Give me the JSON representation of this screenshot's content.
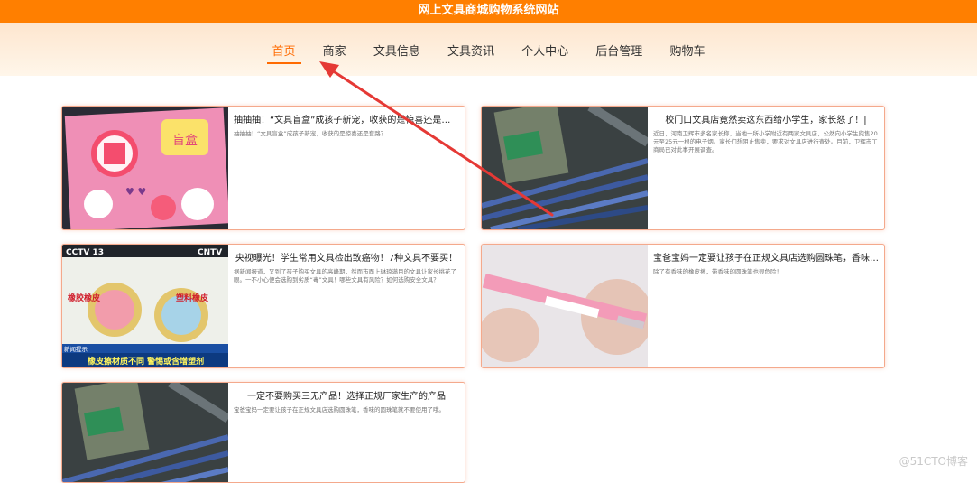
{
  "header": {
    "site_title": "网上文具商城购物系统网站"
  },
  "nav": {
    "items": [
      "首页",
      "商家",
      "文具信息",
      "文具资讯",
      "个人中心",
      "后台管理",
      "购物车"
    ],
    "active": "首页"
  },
  "articles": [
    {
      "title": "抽抽抽！“文具盲盒”成孩子新宠，收获的是惊喜还是套路？",
      "summary": "抽抽抽！“文具盲盒”成孩子新宠，收获的是惊喜还是套路？"
    },
    {
      "title": "校门口文具店竟然卖这东西给小学生，家长怒了！|",
      "summary": "近日，河南卫辉市多名家长称，当地一所小学附近有两家文具店，公然向小学生兜售20元至25元一根的电子烟。家长们想阻止售卖，要求对文具店进行查处。目前，卫辉市工商局已对此事开展调查。"
    },
    {
      "title": "央视曝光！学生常用文具检出致癌物！7种文具不要买！",
      "summary": "据新闻报道，又到了孩子购买文具的高峰期，然而市面上琳琅满目的文具让家长挑花了眼。一不小心便会选购到劣质“毒”文具！哪些文具有风险？如何选购安全文具？"
    },
    {
      "title": "宝爸宝妈一定要让孩子在正规文具店选购圆珠笔，香味的圆珠笔不要使用了哦。",
      "summary": "除了有香味的橡皮擦，带香味的圆珠笔也很危险！"
    },
    {
      "title": "一定不要购买三无产品！选择正规厂家生产的产品",
      "summary": "宝爸宝妈一定要让孩子在正规文具店选购圆珠笔，香味的圆珠笔就不要使用了哦。"
    }
  ],
  "images": {
    "blind_box_cover": "盲盒",
    "tv_logo": "CCTV 13",
    "tv_logo_right": "CNTV",
    "eraser_left_label": "橡胶橡皮",
    "eraser_right_label": "塑料橡皮",
    "tv_caption_small": "新闻提示",
    "tv_caption_main": "橡皮擦材质不同 警惕或含增塑剂"
  },
  "watermark": "@51CTO博客",
  "colors": {
    "topbar": "#ff7f00",
    "nav_active": "#ff6a00",
    "card_border": "#f4a98c",
    "arrow": "#e53935"
  }
}
